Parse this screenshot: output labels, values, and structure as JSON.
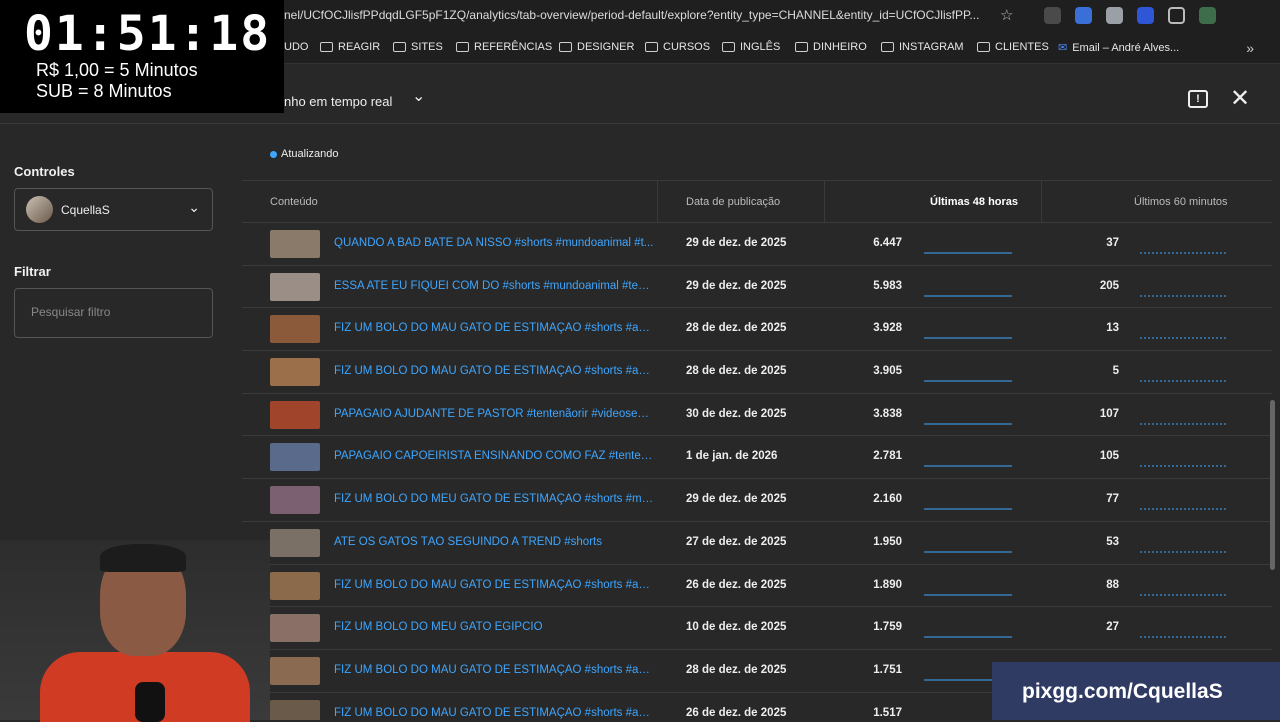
{
  "browser": {
    "url": "nel/UCfOCJlisfPPdqdLGF5pF1ZQ/analytics/tab-overview/period-default/explore?entity_type=CHANNEL&entity_id=UCfOCJlisfPP...",
    "bookmarks": [
      "UDO",
      "REAGIR",
      "SITES",
      "REFERÊNCIAS",
      "DESIGNER",
      "CURSOS",
      "INGLÊS",
      "DINHEIRO",
      "INSTAGRAM",
      "CLIENTES",
      "Email – André Alves..."
    ]
  },
  "overlay": {
    "timer": "01:51:18",
    "line1": "R$ 1,00 = 5 Minutos",
    "line2": "SUB = 8 Minutos",
    "pix": "pixgg.com/CquellaS"
  },
  "header": {
    "title": "nho em tempo real"
  },
  "sidebar": {
    "controls_label": "Controles",
    "channel_name": "CquellaS",
    "filter_label": "Filtrar",
    "filter_placeholder": "Pesquisar filtro"
  },
  "status": "Atualizando",
  "table": {
    "columns": [
      "Conteúdo",
      "Data de publicação",
      "Últimas 48 horas",
      "Últimos 60 minutos"
    ],
    "rows": [
      {
        "title": "QUANDO A BAD BATE DÁ NISSO #shorts #mundoanimal #t...",
        "date": "29 de dez. de 2025",
        "views48": "6.447",
        "views60": "37"
      },
      {
        "title": "ESSA ATÉ EU FIQUEI COM DÓ #shorts #mundoanimal #tent...",
        "date": "29 de dez. de 2025",
        "views48": "5.983",
        "views60": "205"
      },
      {
        "title": "FIZ UM BOLO DO MAU GATO DE ESTIMAÇÃO #shorts #ani...",
        "date": "28 de dez. de 2025",
        "views48": "3.928",
        "views60": "13"
      },
      {
        "title": "FIZ UM BOLO DO MAU GATO DE ESTIMAÇÃO #shorts #ani...",
        "date": "28 de dez. de 2025",
        "views48": "3.905",
        "views60": "5"
      },
      {
        "title": "PAPAGAIO AJUDANTE DE PASTOR #tentenãorir #videoseng...",
        "date": "30 de dez. de 2025",
        "views48": "3.838",
        "views60": "107"
      },
      {
        "title": "PAPAGAIO CAPOEIRISTA ENSINANDO COMO FAZ #tentena...",
        "date": "1 de jan. de 2026",
        "views48": "2.781",
        "views60": "105"
      },
      {
        "title": "FIZ UM BOLO DO MEU GATO DE ESTIMAÇÃO #shorts #mun...",
        "date": "29 de dez. de 2025",
        "views48": "2.160",
        "views60": "77"
      },
      {
        "title": "ATÉ OS GATOS TÃO SEGUINDO A TREND #shorts",
        "date": "27 de dez. de 2025",
        "views48": "1.950",
        "views60": "53"
      },
      {
        "title": "FIZ UM BOLO DO MAU GATO DE ESTIMAÇÃO #shorts #ani...",
        "date": "26 de dez. de 2025",
        "views48": "1.890",
        "views60": "88"
      },
      {
        "title": "FIZ UM BOLO DO MEU GATO EGÍPCIO",
        "date": "10 de dez. de 2025",
        "views48": "1.759",
        "views60": "27"
      },
      {
        "title": "FIZ UM BOLO DO MAU GATO DE ESTIMAÇÃO #shorts #ani...",
        "date": "28 de dez. de 2025",
        "views48": "1.751",
        "views60": ""
      },
      {
        "title": "FIZ UM BOLO DO MAU GATO DE ESTIMAÇÃO #shorts #ani...",
        "date": "26 de dez. de 2025",
        "views48": "1.517",
        "views60": ""
      }
    ]
  },
  "colors": {
    "accent": "#3ea6ff",
    "background": "#282828"
  }
}
